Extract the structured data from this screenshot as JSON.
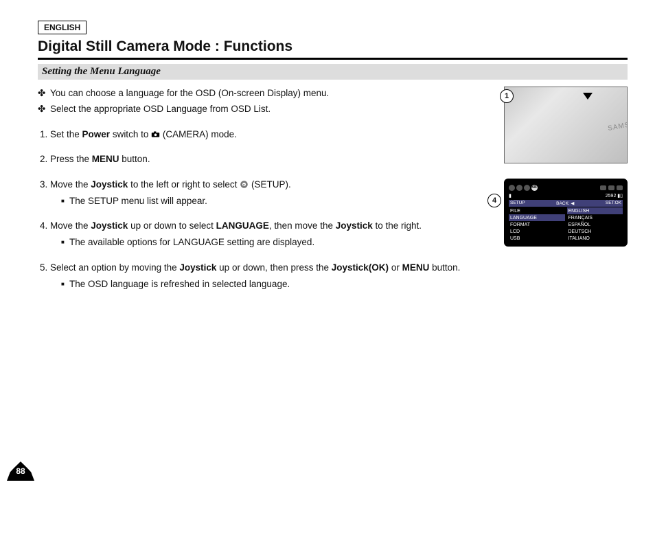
{
  "header": {
    "lang_tag": "ENGLISH",
    "title": "Digital Still Camera Mode : Functions",
    "section": "Setting the Menu Language"
  },
  "intro_bullets": [
    "You can choose a language for the OSD (On-screen Display) menu.",
    "Select the appropriate OSD Language from OSD List."
  ],
  "steps": [
    {
      "pre": "Set the ",
      "bold1": "Power",
      "mid": " switch to ",
      "icon": "camera",
      "post": "(CAMERA) mode.",
      "sub": []
    },
    {
      "pre": "Press the ",
      "bold1": "MENU",
      "mid": "",
      "post": " button.",
      "sub": []
    },
    {
      "pre": "Move the ",
      "bold1": "Joystick",
      "mid": " to the left or right to select  ",
      "icon": "setup",
      "post": " (SETUP).",
      "sub": [
        "The SETUP menu list will appear."
      ]
    },
    {
      "pre": "Move the ",
      "bold1": "Joystick",
      "mid": " up or down to select ",
      "bold2": "LANGUAGE",
      "mid2": ", then move the ",
      "bold3": "Joystick",
      "post": " to the right.",
      "sub": [
        "The available options for LANGUAGE setting are displayed."
      ]
    },
    {
      "pre": "Select an option by moving the ",
      "bold1": "Joystick",
      "mid": " up or down, then press the ",
      "bold2": "Joystick(OK)",
      "mid2": " or ",
      "bold3": "MENU",
      "post": " button.",
      "sub": [
        "The OSD language is refreshed in selected language."
      ]
    }
  ],
  "figures": {
    "fig1_num": "1",
    "fig4_num": "4"
  },
  "osd": {
    "selected_tab": "SET",
    "counter": "2592",
    "bar_left": "SETUP",
    "bar_mid": "BACK: ◀",
    "bar_right": "SET:OK",
    "left_col": [
      "FILE",
      "LANGUAGE",
      "FORMAT",
      "LCD",
      "USB"
    ],
    "left_selected_index": 1,
    "right_col": [
      "ENGLISH",
      "FRANÇAIS",
      "ESPAÑOL",
      "DEUTSCH",
      "ITALIANO"
    ],
    "right_selected_index": 0
  },
  "page_number": "88"
}
